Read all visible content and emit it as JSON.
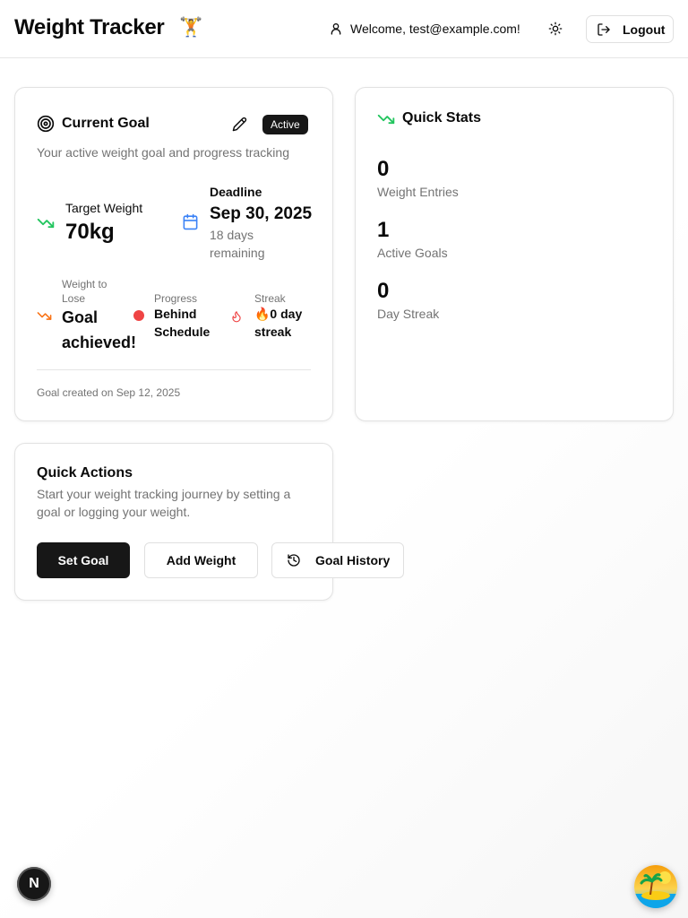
{
  "header": {
    "title": "Weight Tracker",
    "emoji": "🏋️",
    "welcome": "Welcome, test@example.com!",
    "logout_label": "Logout",
    "icons": {
      "user": "user-icon",
      "theme": "sun-icon",
      "logout": "logout-icon"
    }
  },
  "goal_card": {
    "title": "Current Goal",
    "badge": "Active",
    "subtitle": "Your active weight goal and progress tracking",
    "target_label": "Target Weight",
    "target_value": "70kg",
    "deadline_label": "Deadline",
    "deadline_value": "Sep 30, 2025",
    "deadline_remaining_1": "18 days",
    "deadline_remaining_2": "remaining",
    "lose_label_1": "Weight to",
    "lose_label_2": "Lose",
    "lose_value_1": "Goal",
    "lose_value_2": "achieved!",
    "progress_label": "Progress",
    "progress_value_1": "Behind",
    "progress_value_2": "Schedule",
    "streak_label": "Streak",
    "streak_value_1": "🔥0 day",
    "streak_value_2": "streak",
    "footer": "Goal created on Sep 12, 2025",
    "colors": {
      "trend_green": "#22c55e",
      "trend_orange": "#f97316",
      "calendar_blue": "#3b82f6",
      "status_red": "#ef4444",
      "flame_red": "#ef4444"
    }
  },
  "stats_card": {
    "title": "Quick Stats",
    "stats": [
      {
        "value": "0",
        "label": "Weight Entries"
      },
      {
        "value": "1",
        "label": "Active Goals"
      },
      {
        "value": "0",
        "label": "Day Streak"
      }
    ]
  },
  "actions_card": {
    "title": "Quick Actions",
    "desc_1": "Start your weight tracking journey by setting a",
    "desc_2": "goal or logging your weight.",
    "set_goal": "Set Goal",
    "add_weight": "Add Weight",
    "goal_history": "Goal History"
  },
  "dev": {
    "next_badge": "N"
  }
}
